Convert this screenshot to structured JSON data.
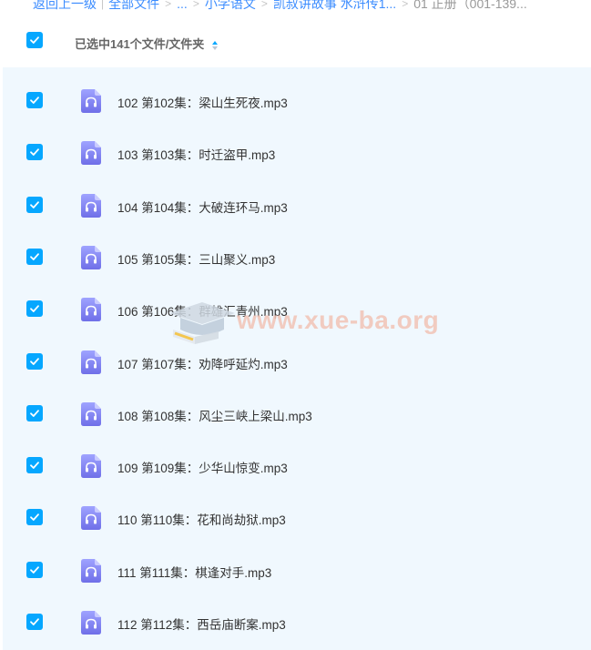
{
  "breadcrumb": {
    "back": "返回上一级",
    "all_files": "全部文件",
    "ellipsis": "...",
    "level1": "小学语文",
    "level2": "凯叔讲故事 水浒传1...",
    "current": "01 正册（001-139..."
  },
  "header": {
    "selected_label": "已选中141个文件/文件夹"
  },
  "files": [
    {
      "name": "102 第102集：梁山生死夜.mp3"
    },
    {
      "name": "103 第103集：时迁盗甲.mp3"
    },
    {
      "name": "104 第104集：大破连环马.mp3"
    },
    {
      "name": "105 第105集：三山聚义.mp3"
    },
    {
      "name": "106 第106集：群雄汇青州.mp3"
    },
    {
      "name": "107 第107集：劝降呼延灼.mp3"
    },
    {
      "name": "108 第108集：风尘三峡上梁山.mp3"
    },
    {
      "name": "109 第109集：少华山惊变.mp3"
    },
    {
      "name": "110 第110集：花和尚劫狱.mp3"
    },
    {
      "name": "111 第111集：棋逢对手.mp3"
    },
    {
      "name": "112 第112集：西岳庙断案.mp3"
    }
  ],
  "watermark": {
    "text": "www.xue-ba.org"
  },
  "icons": {
    "checkbox": "checkmark-icon",
    "file": "audio-file-icon",
    "sort": "sort-icon"
  },
  "colors": {
    "accent": "#06a7ff",
    "link": "#3b8cff",
    "list_background": "#f0f8fe",
    "file_icon": "#7b7ef6",
    "watermark": "#f2c4b6"
  }
}
